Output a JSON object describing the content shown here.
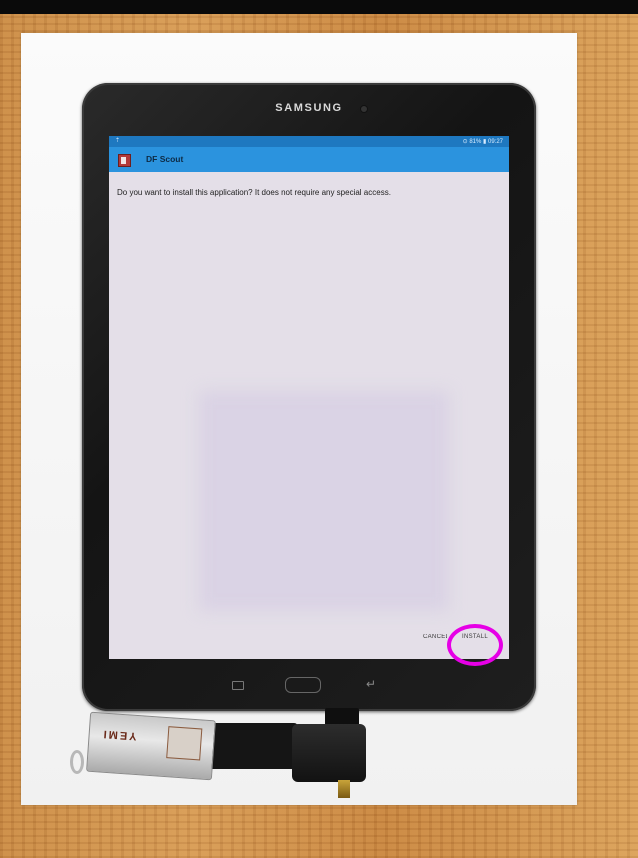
{
  "tablet": {
    "brand": "SAMSUNG"
  },
  "status_bar": {
    "left_icon": "android-icon",
    "right": "⊙ 81% ▮ 09:27"
  },
  "app": {
    "title": "DF Scout",
    "icon": "app-icon"
  },
  "dialog": {
    "question": "Do you want to install this application? It does not require any special access.",
    "cancel_label": "CANCEL",
    "install_label": "INSTALL"
  },
  "usb_stick": {
    "label": "YEMI"
  },
  "colors": {
    "app_bar": "#2b93de",
    "status_bar": "#1e78c0",
    "highlight": "#e600e6",
    "screen": "#e4dfe8"
  }
}
